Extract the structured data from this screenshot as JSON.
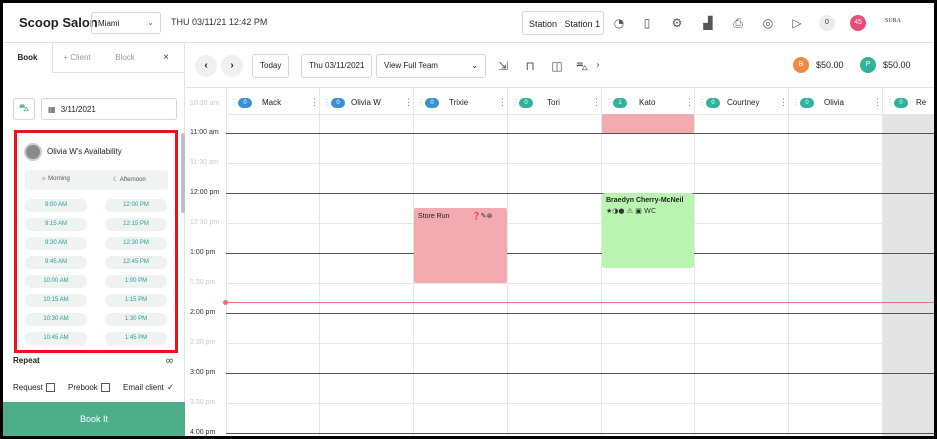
{
  "app": {
    "brand": "Scoop Salon",
    "location": "Miami",
    "datetime": "THU 03/11/21  12:42 PM",
    "station_label": "Station",
    "station_value": "Station 1",
    "pill_zero": "0",
    "pill_45": "45",
    "user_logo": "SURA",
    "icons": [
      "speedometer-icon",
      "door-icon",
      "register-icon",
      "building-icon",
      "printer-icon",
      "help-ring-icon",
      "play-icon"
    ]
  },
  "left": {
    "tabs": [
      "Book",
      "+ Client",
      "Block"
    ],
    "close": "×",
    "date": "3/11/2021",
    "availability": {
      "title": "Olivia W's Availability",
      "col_morning": "Morning",
      "col_afternoon": "Afternoon",
      "morning": [
        "9:00 AM",
        "9:15 AM",
        "9:30 AM",
        "9:45 AM",
        "10:00 AM",
        "10:15 AM",
        "10:30 AM",
        "10:45 AM"
      ],
      "afternoon": [
        "12:00 PM",
        "12:15 PM",
        "12:30 PM",
        "12:45 PM",
        "1:00 PM",
        "1:15 PM",
        "1:30 PM",
        "1:45 PM"
      ]
    },
    "repeat_label": "Repeat",
    "request_label": "Request",
    "prebook_label": "Prebook",
    "email_label": "Email client",
    "book_label": "Book It"
  },
  "toolbar": {
    "today": "Today",
    "date": "Thu 03/11/2021",
    "view": "View Full Team",
    "badge_b": "B",
    "amount_b": "$50.00",
    "badge_p": "P",
    "amount_p": "$50.00"
  },
  "calendar": {
    "columns": [
      {
        "name": "Mack",
        "count": "0"
      },
      {
        "name": "Olivia W",
        "count": "0"
      },
      {
        "name": "Trixie",
        "count": "0"
      },
      {
        "name": "Tori",
        "count": "0"
      },
      {
        "name": "Kato",
        "count": "1"
      },
      {
        "name": "Courtney",
        "count": "0"
      },
      {
        "name": "Olivia",
        "count": "0"
      },
      {
        "name": "Re",
        "count": "0"
      }
    ],
    "times": [
      "10:30 am",
      "11:00 am",
      "11:30 am",
      "12:00 pm",
      "12:30 pm",
      "1:00 pm",
      "1:30 pm",
      "2:00 pm",
      "2:30 pm",
      "3:00 pm",
      "3:30 pm",
      "4:00 pm"
    ],
    "appointments": [
      {
        "title": "Store Run",
        "icons": "❓✎⊗"
      },
      {
        "title": "Braedyn Cherry-McNeil",
        "icons": "★◑● ⚠ ▣ WC"
      }
    ]
  },
  "colors": {
    "accent": "#4caf8a",
    "highlight_border": "#e8141b",
    "block_pink": "#f3aab1",
    "appt_green": "#b9f5b0",
    "count_blue": "#3a8fd0",
    "badge_b": "#f08a3c",
    "badge_p": "#2fb39a"
  }
}
